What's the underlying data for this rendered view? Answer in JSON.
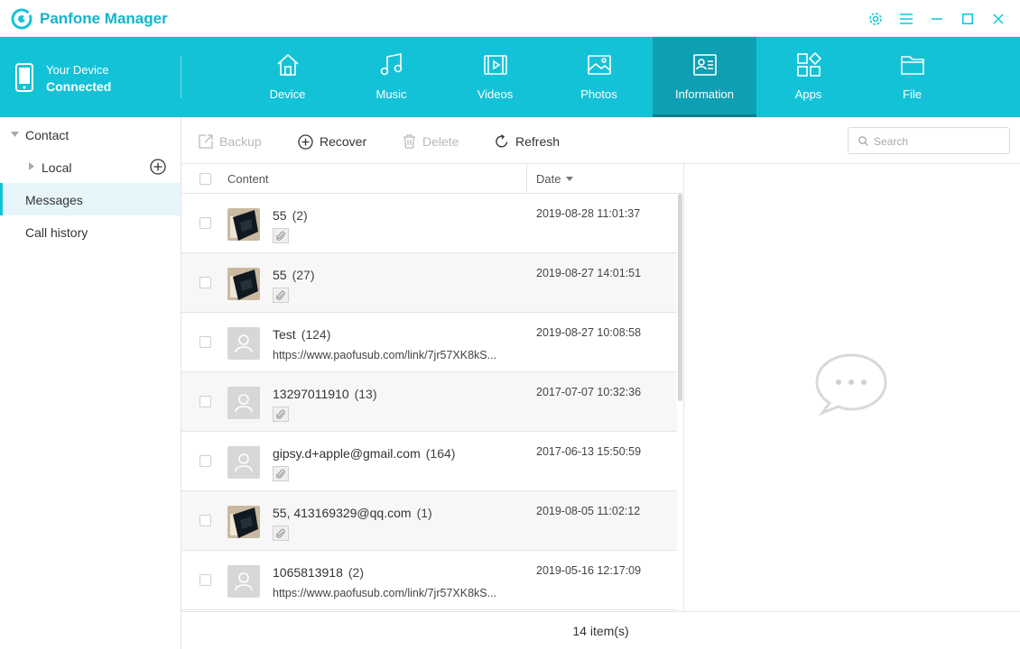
{
  "app": {
    "title": "Panfone Manager",
    "brand_color": "#14c2d8"
  },
  "window_controls": [
    "gear-icon",
    "menu-icon",
    "minimize-icon",
    "maximize-icon",
    "close-icon"
  ],
  "device": {
    "line1": "Your Device",
    "line2": "Connected"
  },
  "tabs": [
    {
      "label": "Device",
      "icon": "home-icon"
    },
    {
      "label": "Music",
      "icon": "music-icon"
    },
    {
      "label": "Videos",
      "icon": "video-icon"
    },
    {
      "label": "Photos",
      "icon": "photo-icon"
    },
    {
      "label": "Information",
      "icon": "contact-card-icon",
      "active": true
    },
    {
      "label": "Apps",
      "icon": "apps-icon"
    },
    {
      "label": "File",
      "icon": "folder-icon"
    }
  ],
  "sidebar": {
    "items": [
      {
        "label": "Contact"
      },
      {
        "label": "Local"
      },
      {
        "label": "Messages",
        "active": true
      },
      {
        "label": "Call history"
      }
    ]
  },
  "toolbar": {
    "backup": "Backup",
    "recover": "Recover",
    "delete": "Delete",
    "refresh": "Refresh",
    "search_placeholder": "Search"
  },
  "list": {
    "headers": {
      "content": "Content",
      "date": "Date"
    },
    "rows": [
      {
        "name": "55",
        "count": "(2)",
        "date": "2019-08-28 11:01:37",
        "thumb": "photo",
        "attachment": true
      },
      {
        "name": "55",
        "count": "(27)",
        "date": "2019-08-27 14:01:51",
        "thumb": "photo",
        "attachment": true
      },
      {
        "name": "Test",
        "count": "(124)",
        "date": "2019-08-27 10:08:58",
        "thumb": "avatar",
        "preview": "https://www.paofusub.com/link/7jr57XK8kS..."
      },
      {
        "name": "13297011910",
        "count": "(13)",
        "date": "2017-07-07 10:32:36",
        "thumb": "avatar",
        "attachment": true
      },
      {
        "name": "gipsy.d+apple@gmail.com",
        "count": "(164)",
        "date": "2017-06-13 15:50:59",
        "thumb": "avatar",
        "attachment": true
      },
      {
        "name": "55, 413169329@qq.com",
        "count": "(1)",
        "date": "2019-08-05 11:02:12",
        "thumb": "photo",
        "attachment": true
      },
      {
        "name": "1065813918",
        "count": "(2)",
        "date": "2019-05-16 12:17:09",
        "thumb": "avatar",
        "preview": "https://www.paofusub.com/link/7jr57XK8kS..."
      }
    ]
  },
  "footer": {
    "count": "14 item(s)"
  }
}
